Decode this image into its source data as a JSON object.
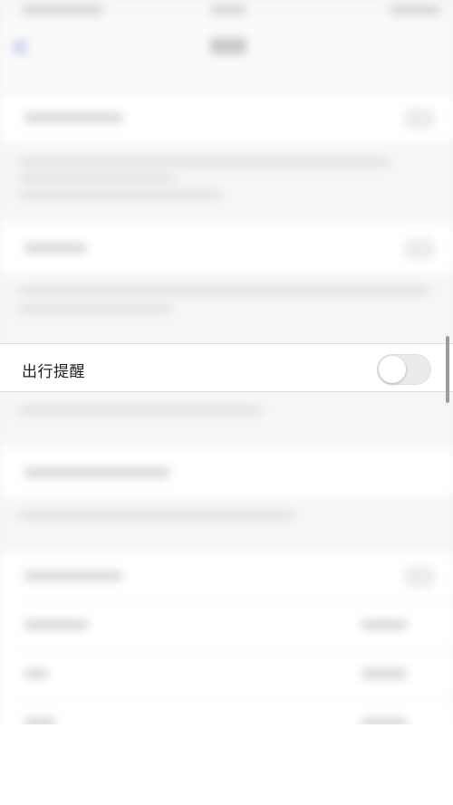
{
  "settings": {
    "travel_reminder": {
      "label": "出行提醒",
      "toggle_on": false
    }
  },
  "colors": {
    "background": "#f4f4f5",
    "toggle_off_track": "#ebebeb",
    "toggle_knob": "#ffffff",
    "scrollbar": "#9c9c9c"
  }
}
